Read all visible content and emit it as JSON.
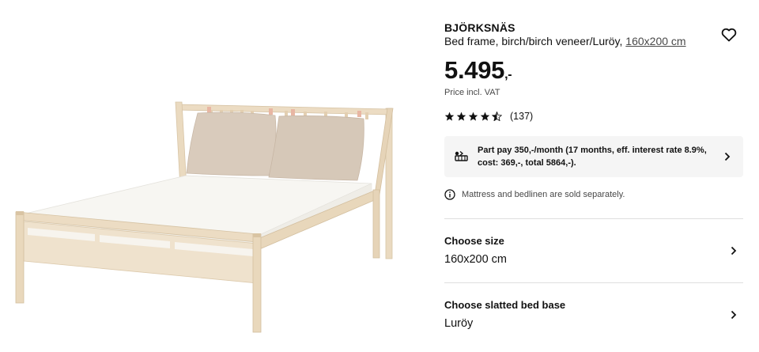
{
  "product": {
    "name": "BJÖRKSNÄS",
    "description_prefix": "Bed frame, birch/birch veneer/Luröy, ",
    "size_link": "160x200 cm",
    "price_integer": "5.495",
    "price_suffix": ",-",
    "price_note": "Price incl. VAT",
    "image_subject": "bed-frame-product-image"
  },
  "rating": {
    "stars": 4.5,
    "max_stars": 5,
    "count": "(137)"
  },
  "part_pay": {
    "text": "Part pay 350,-/month (17 months, eff. interest rate 8.9%, cost: 369,-, total 5864,-)."
  },
  "notice": {
    "text": "Mattress and bedlinen are sold separately."
  },
  "choices": [
    {
      "title": "Choose size",
      "value": "160x200 cm"
    },
    {
      "title": "Choose slatted bed base",
      "value": "Luröy"
    }
  ],
  "colors": {
    "text": "#111111",
    "muted": "#484848",
    "panel_bg": "#f5f5f5",
    "divider": "#dfdfdf",
    "wood": "#ecdcc3",
    "pillow": "#d9cbbc"
  }
}
